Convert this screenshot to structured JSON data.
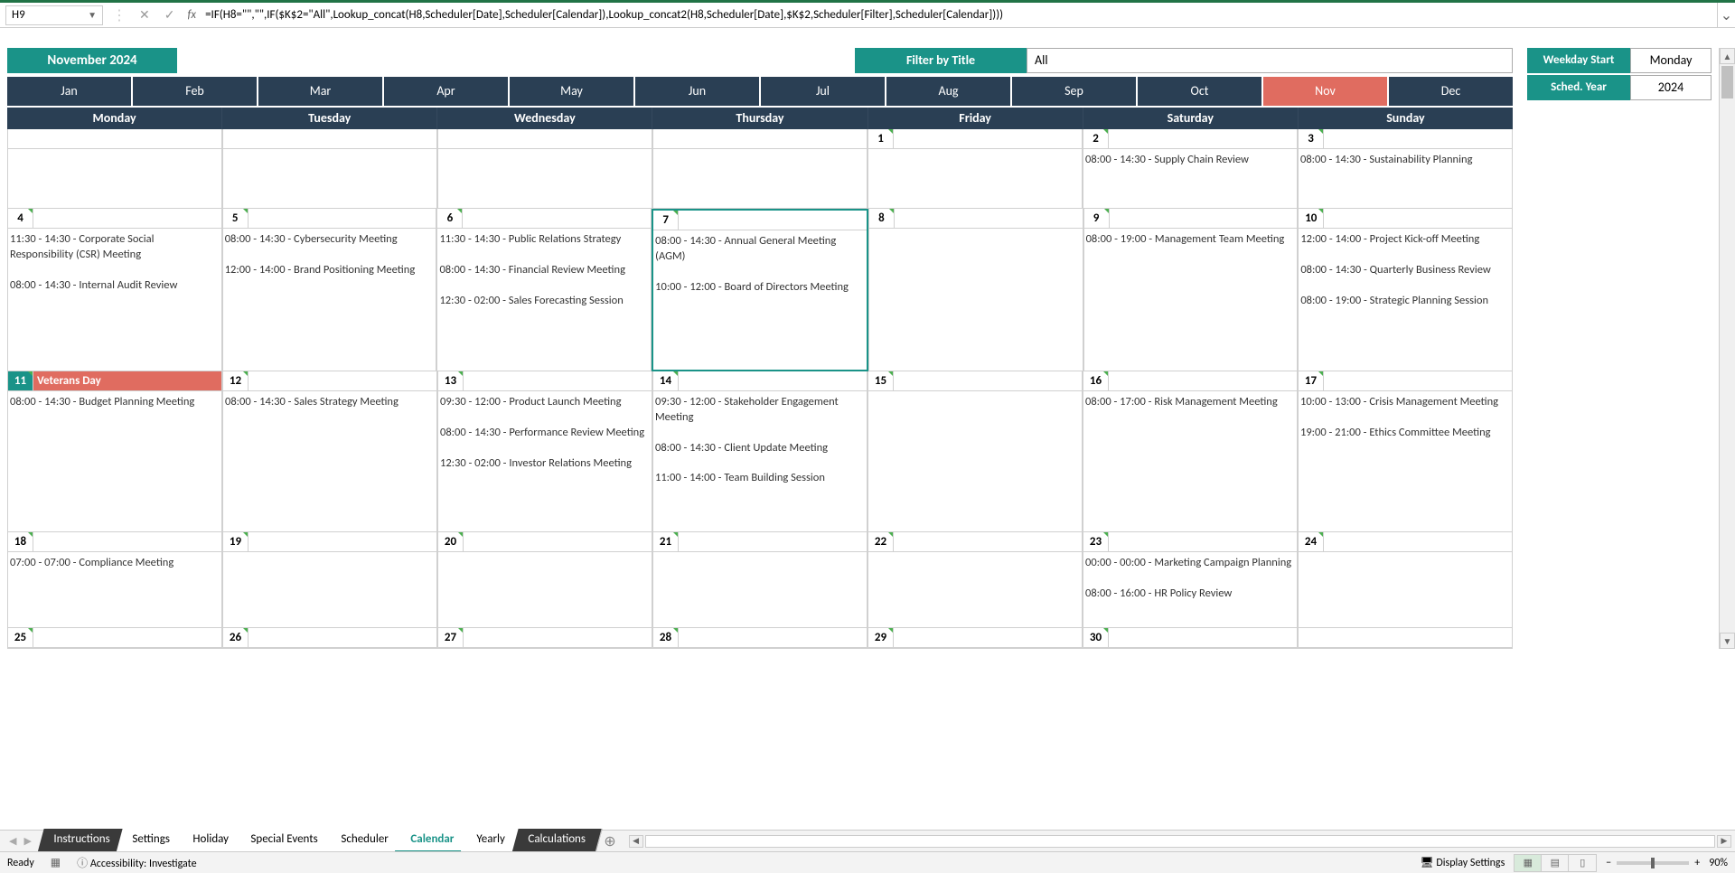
{
  "formula_bar": {
    "name_box": "H9",
    "cancel": "✕",
    "confirm": "✓",
    "fx": "fx",
    "formula": "=IF(H8=\"\",\"\",IF($K$2=\"All\",Lookup_concat(H8,Scheduler[Date],Scheduler[Calendar]),Lookup_concat2(H8,Scheduler[Date],$K$2,Scheduler[Filter],Scheduler[Calendar])))"
  },
  "header": {
    "month_title": "November 2024",
    "filter_label": "Filter by Title",
    "filter_value": "All"
  },
  "side": {
    "weekday_start_label": "Weekday Start",
    "weekday_start_value": "Monday",
    "sched_year_label": "Sched. Year",
    "sched_year_value": "2024"
  },
  "months": [
    "Jan",
    "Feb",
    "Mar",
    "Apr",
    "May",
    "Jun",
    "Jul",
    "Aug",
    "Sep",
    "Oct",
    "Nov",
    "Dec"
  ],
  "active_month": "Nov",
  "day_headers": [
    "Monday",
    "Tuesday",
    "Wednesday",
    "Thursday",
    "Friday",
    "Saturday",
    "Sunday"
  ],
  "weeks": [
    {
      "cls": "h1",
      "days": [
        {
          "num": "",
          "events": ""
        },
        {
          "num": "",
          "events": ""
        },
        {
          "num": "",
          "events": ""
        },
        {
          "num": "",
          "events": ""
        },
        {
          "num": "1",
          "events": ""
        },
        {
          "num": "2",
          "events": "08:00 - 14:30 - Supply Chain Review"
        },
        {
          "num": "3",
          "events": "08:00 - 14:30 - Sustainability Planning"
        }
      ]
    },
    {
      "cls": "h2",
      "days": [
        {
          "num": "4",
          "events": "11:30 - 14:30 - Corporate Social Responsibility (CSR) Meeting\n\n08:00 - 14:30 - Internal Audit Review"
        },
        {
          "num": "5",
          "events": "08:00 - 14:30 - Cybersecurity Meeting\n\n12:00 - 14:00 - Brand Positioning Meeting"
        },
        {
          "num": "6",
          "events": "11:30 - 14:30 - Public Relations Strategy\n\n08:00 - 14:30 - Financial Review Meeting\n\n12:30 - 02:00 - Sales Forecasting Session"
        },
        {
          "num": "7",
          "events": "08:00 - 14:30 - Annual General Meeting (AGM)\n\n10:00 - 12:00 - Board of Directors Meeting",
          "selected": true
        },
        {
          "num": "8",
          "events": ""
        },
        {
          "num": "9",
          "events": "08:00 - 19:00 - Management Team Meeting"
        },
        {
          "num": "10",
          "events": "12:00 - 14:00 - Project Kick-off Meeting\n\n08:00 - 14:30 - Quarterly Business Review\n\n08:00 - 19:00 - Strategic Planning Session"
        }
      ]
    },
    {
      "cls": "h3",
      "days": [
        {
          "num": "11",
          "label": "Veterans Day",
          "holiday": true,
          "events": "08:00 - 14:30 - Budget Planning Meeting"
        },
        {
          "num": "12",
          "events": "08:00 - 14:30 - Sales Strategy Meeting"
        },
        {
          "num": "13",
          "events": "09:30 - 12:00 - Product Launch Meeting\n\n08:00 - 14:30 - Performance Review Meeting\n\n12:30 - 02:00 - Investor Relations Meeting"
        },
        {
          "num": "14",
          "events": "09:30 - 12:00 - Stakeholder Engagement Meeting\n\n08:00 - 14:30 - Client Update Meeting\n\n11:00 - 14:00 - Team Building Session"
        },
        {
          "num": "15",
          "events": ""
        },
        {
          "num": "16",
          "events": "08:00 - 17:00 - Risk Management Meeting"
        },
        {
          "num": "17",
          "events": "10:00 - 13:00 - Crisis Management Meeting\n\n19:00 - 21:00 - Ethics Committee Meeting"
        }
      ]
    },
    {
      "cls": "h4",
      "days": [
        {
          "num": "18",
          "events": "07:00 - 07:00 - Compliance Meeting"
        },
        {
          "num": "19",
          "events": ""
        },
        {
          "num": "20",
          "events": ""
        },
        {
          "num": "21",
          "events": ""
        },
        {
          "num": "22",
          "events": ""
        },
        {
          "num": "23",
          "events": "00:00 - 00:00 - Marketing Campaign Planning\n\n08:00 - 16:00 - HR Policy Review"
        },
        {
          "num": "24",
          "events": ""
        }
      ]
    },
    {
      "cls": "h5",
      "days": [
        {
          "num": "25",
          "events": ""
        },
        {
          "num": "26",
          "events": ""
        },
        {
          "num": "27",
          "events": ""
        },
        {
          "num": "28",
          "events": ""
        },
        {
          "num": "29",
          "events": ""
        },
        {
          "num": "30",
          "events": ""
        },
        {
          "num": "",
          "events": ""
        }
      ]
    }
  ],
  "tabs": {
    "items": [
      {
        "label": "Instructions",
        "cls": "dark"
      },
      {
        "label": "Settings",
        "cls": ""
      },
      {
        "label": "Holiday",
        "cls": ""
      },
      {
        "label": "Special Events",
        "cls": ""
      },
      {
        "label": "Scheduler",
        "cls": ""
      },
      {
        "label": "Calendar",
        "cls": "active"
      },
      {
        "label": "Yearly",
        "cls": ""
      },
      {
        "label": "Calculations",
        "cls": "dark"
      }
    ]
  },
  "status": {
    "ready": "Ready",
    "accessibility": "Accessibility: Investigate",
    "display_settings": "Display Settings",
    "zoom": "90%"
  }
}
